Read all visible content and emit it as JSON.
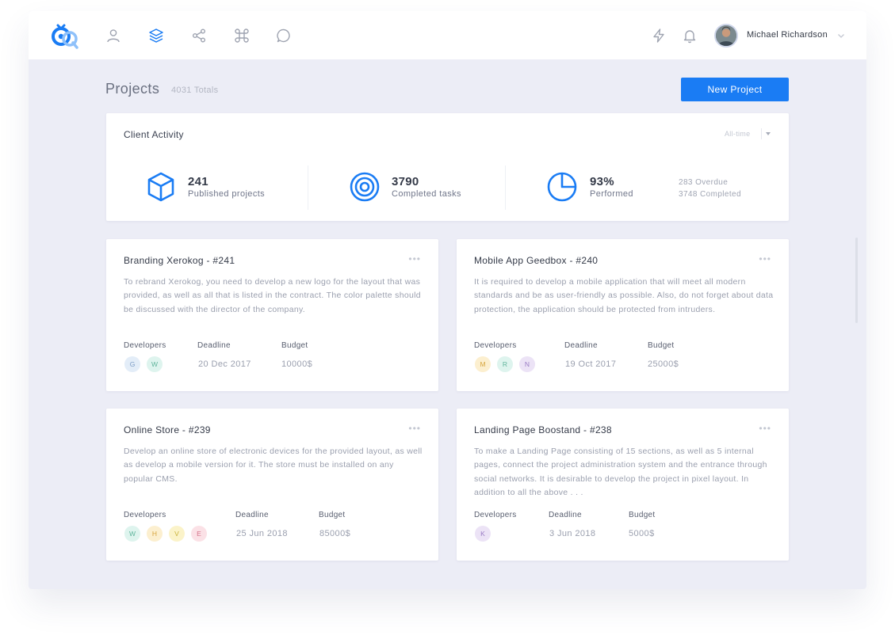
{
  "header": {
    "user_name": "Michael Richardson"
  },
  "colors": {
    "accent": "#1a7cf4"
  },
  "nav": {
    "icons": [
      "user-icon",
      "layers-icon",
      "share-icon",
      "command-icon",
      "chat-icon"
    ],
    "right_icons": [
      "bolt-icon",
      "bell-icon",
      "chevron-down-icon"
    ]
  },
  "page": {
    "title": "Projects",
    "total": "4031 Totals",
    "new_button": "New Project"
  },
  "activity": {
    "title": "Client Activity",
    "range": "All-time",
    "stats": [
      {
        "icon": "cube-icon",
        "value": "241",
        "label": "Published projects"
      },
      {
        "icon": "target-icon",
        "value": "3790",
        "label": "Completed tasks"
      },
      {
        "icon": "pie-chart-icon",
        "value": "93%",
        "label": "Performed"
      }
    ],
    "side_notes": [
      "283 Overdue",
      "3748 Completed"
    ]
  },
  "labels": {
    "developers": "Developers",
    "deadline": "Deadline",
    "budget": "Budget"
  },
  "projects": [
    {
      "title": "Branding Xerokog - #241",
      "description": "To rebrand Xerokog, you need to develop a new logo for the layout that was provided, as well as all that is listed in the contract. The color palette should be discussed with the director of the company.",
      "developers": [
        {
          "initial": "G",
          "bg": "#e3edf8",
          "fg": "#7b9bc4"
        },
        {
          "initial": "W",
          "bg": "#def4ee",
          "fg": "#5fb49b"
        }
      ],
      "deadline": "20 Dec 2017",
      "budget": "10000$"
    },
    {
      "title": "Mobile App Geedbox - #240",
      "description": "It is required to develop a mobile application that will meet all modern standards and be as user-friendly as possible. Also, do not forget about data protection, the application should be protected from intruders.",
      "developers": [
        {
          "initial": "M",
          "bg": "#fcefcf",
          "fg": "#d6a53e"
        },
        {
          "initial": "R",
          "bg": "#def4ee",
          "fg": "#5fb49b"
        },
        {
          "initial": "N",
          "bg": "#ece3f6",
          "fg": "#9a7cc4"
        }
      ],
      "deadline": "19 Oct 2017",
      "budget": "25000$"
    },
    {
      "title": "Online Store - #239",
      "description": "Develop an online store of electronic devices for the provided layout, as well as develop a mobile version for it. The store must be installed on any popular CMS.",
      "developers": [
        {
          "initial": "W",
          "bg": "#def4ee",
          "fg": "#5fb49b"
        },
        {
          "initial": "H",
          "bg": "#fcefcf",
          "fg": "#d6a53e"
        },
        {
          "initial": "V",
          "bg": "#fbf3c9",
          "fg": "#c9b23b"
        },
        {
          "initial": "E",
          "bg": "#fbe1e6",
          "fg": "#d5738a"
        }
      ],
      "deadline": "25 Jun 2018",
      "budget": "85000$"
    },
    {
      "title": "Landing Page Boostand - #238",
      "description": "To make a Landing Page consisting of 15 sections, as well as 5 internal pages, connect the project administration system and the entrance through social networks. It is desirable to develop the project in pixel layout. In addition to all the above . . .",
      "developers": [
        {
          "initial": "K",
          "bg": "#ece3f6",
          "fg": "#9a7cc4"
        }
      ],
      "deadline": "3 Jun 2018",
      "budget": "5000$"
    }
  ]
}
